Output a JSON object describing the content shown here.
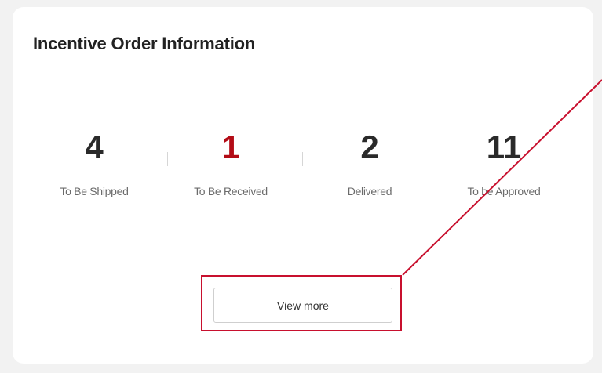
{
  "card": {
    "title": "Incentive Order Information"
  },
  "stats": [
    {
      "value": "4",
      "label": "To Be Shipped"
    },
    {
      "value": "1",
      "label": "To Be Received"
    },
    {
      "value": "2",
      "label": "Delivered"
    },
    {
      "value": "11",
      "label": "To be Approved"
    }
  ],
  "actions": {
    "view_more_label": "View more"
  },
  "colors": {
    "highlight_value": "#b30c16",
    "annotation": "#c8102e",
    "card_background": "#ffffff",
    "page_background": "#f2f2f2"
  }
}
